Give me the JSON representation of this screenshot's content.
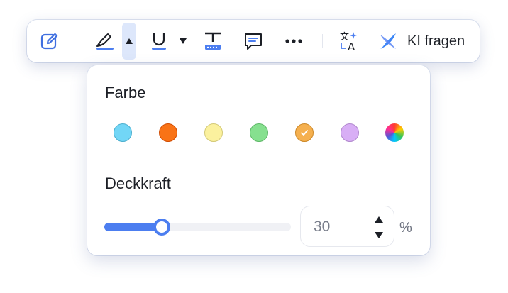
{
  "toolbar": {
    "items": [
      {
        "name": "edit-icon"
      },
      {
        "name": "highlighter-icon"
      },
      {
        "name": "underline-icon"
      },
      {
        "name": "textbox-icon"
      },
      {
        "name": "comment-icon"
      },
      {
        "name": "more-icon"
      },
      {
        "name": "translate-icon"
      },
      {
        "name": "ai-icon"
      }
    ],
    "ai_label": "KI fragen",
    "accent": "#4c7ef0"
  },
  "popover": {
    "color_heading": "Farbe",
    "opacity_heading": "Deckkraft",
    "colors": [
      {
        "name": "light-blue",
        "hex": "#72d6f6",
        "selected": false
      },
      {
        "name": "orange",
        "hex": "#f97316",
        "selected": false
      },
      {
        "name": "light-yellow",
        "hex": "#fbf19e",
        "selected": false
      },
      {
        "name": "green",
        "hex": "#86e08f",
        "selected": false
      },
      {
        "name": "amber",
        "hex": "#f5b04f",
        "selected": true
      },
      {
        "name": "lavender",
        "hex": "#d8aef5",
        "selected": false
      },
      {
        "name": "custom-color",
        "hex": "rainbow",
        "selected": false
      }
    ],
    "opacity": {
      "value": "30",
      "percent_fraction": 0.3,
      "unit": "%"
    }
  }
}
